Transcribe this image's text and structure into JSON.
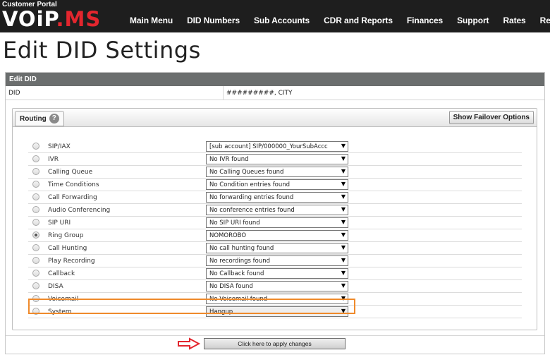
{
  "header": {
    "portal_label": "Customer Portal",
    "logo_part1": "VOiP",
    "logo_part2": ".MS",
    "nav": [
      "Main Menu",
      "DID Numbers",
      "Sub Accounts",
      "CDR and Reports",
      "Finances",
      "Support",
      "Rates",
      "Reseller"
    ]
  },
  "page": {
    "title": "Edit DID Settings"
  },
  "panel": {
    "header": "Edit DID",
    "did_label": "DID",
    "did_value": "#########, CITY"
  },
  "routing": {
    "tab_label": "Routing",
    "help_glyph": "?",
    "failover_button": "Show Failover Options",
    "options": [
      {
        "label": "SIP/IAX",
        "value": "[sub account] SIP/000000_YourSubAccc",
        "checked": false
      },
      {
        "label": "IVR",
        "value": "No IVR found",
        "checked": false
      },
      {
        "label": "Calling Queue",
        "value": "No Calling Queues found",
        "checked": false
      },
      {
        "label": "Time Conditions",
        "value": "No Condition entries found",
        "checked": false
      },
      {
        "label": "Call Forwarding",
        "value": "No forwarding entries found",
        "checked": false
      },
      {
        "label": "Audio Conferencing",
        "value": "No conference entries found",
        "checked": false
      },
      {
        "label": "SIP URI",
        "value": "No SIP URI found",
        "checked": false
      },
      {
        "label": "Ring Group",
        "value": "NOMOROBO",
        "checked": true
      },
      {
        "label": "Call Hunting",
        "value": "No call hunting found",
        "checked": false
      },
      {
        "label": "Play Recording",
        "value": "No recordings found",
        "checked": false
      },
      {
        "label": "Callback",
        "value": "No Callback found",
        "checked": false
      },
      {
        "label": "DISA",
        "value": "No DISA found",
        "checked": false
      },
      {
        "label": "Voicemail",
        "value": "No Voicemail found",
        "checked": false
      },
      {
        "label": "System",
        "value": "Hangup",
        "checked": false
      }
    ]
  },
  "apply": {
    "label": "Click here to apply changes"
  },
  "colors": {
    "topbar": "#1e1e1e",
    "logo_accent": "#e3262e",
    "panel_header": "#6b6e6e",
    "highlight": "#ef8a2b",
    "arrow": "#e3262e"
  },
  "icons": {
    "help": "help-icon",
    "dropdown": "chevron-down-icon",
    "pointer": "arrow-right-icon"
  }
}
